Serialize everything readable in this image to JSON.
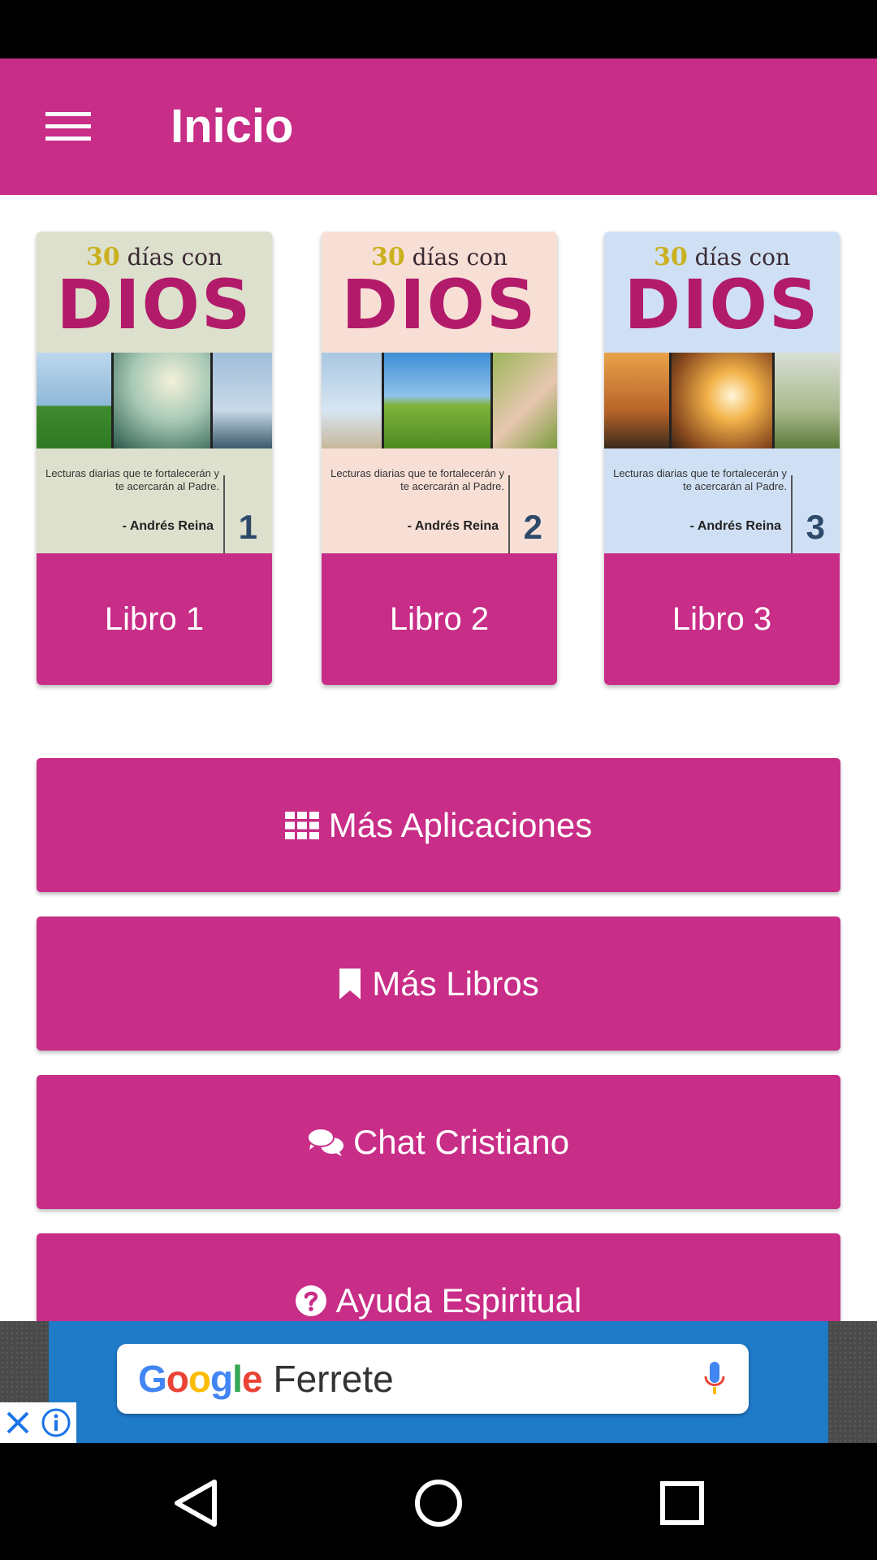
{
  "app": {
    "title": "Inicio",
    "accent": "#c82d87"
  },
  "books": [
    {
      "cover_pre_number": "30",
      "cover_pre_text": " días con",
      "cover_title": "DIOS",
      "cover_text": "Lecturas diarias que te fortalecerán y te acercarán al Padre.",
      "cover_author": "- Andrés Reina",
      "cover_number": "1",
      "label": "Libro 1",
      "cover_bg": "#dde0cc"
    },
    {
      "cover_pre_number": "30",
      "cover_pre_text": " días con",
      "cover_title": "DIOS",
      "cover_text": "Lecturas diarias que te fortalecerán y te acercarán al Padre.",
      "cover_author": "- Andrés Reina",
      "cover_number": "2",
      "label": "Libro 2",
      "cover_bg": "#f8dfd6"
    },
    {
      "cover_pre_number": "30",
      "cover_pre_text": " días con",
      "cover_title": "DIOS",
      "cover_text": "Lecturas diarias que te fortalecerán y te acercarán al Padre.",
      "cover_author": "- Andrés Reina",
      "cover_number": "3",
      "label": "Libro 3",
      "cover_bg": "#cfe0f5"
    }
  ],
  "actions": [
    {
      "label": "Más Aplicaciones",
      "icon": "grid-icon"
    },
    {
      "label": "Más Libros",
      "icon": "bookmark-icon"
    },
    {
      "label": "Chat Cristiano",
      "icon": "chat-bubbles-icon"
    },
    {
      "label": "Ayuda Espiritual",
      "icon": "question-circle-icon"
    }
  ],
  "ad": {
    "search_logo": "Google",
    "search_query": "Ferrete"
  },
  "nav": {
    "back": "back-icon",
    "home": "home-icon",
    "recents": "recents-icon"
  }
}
